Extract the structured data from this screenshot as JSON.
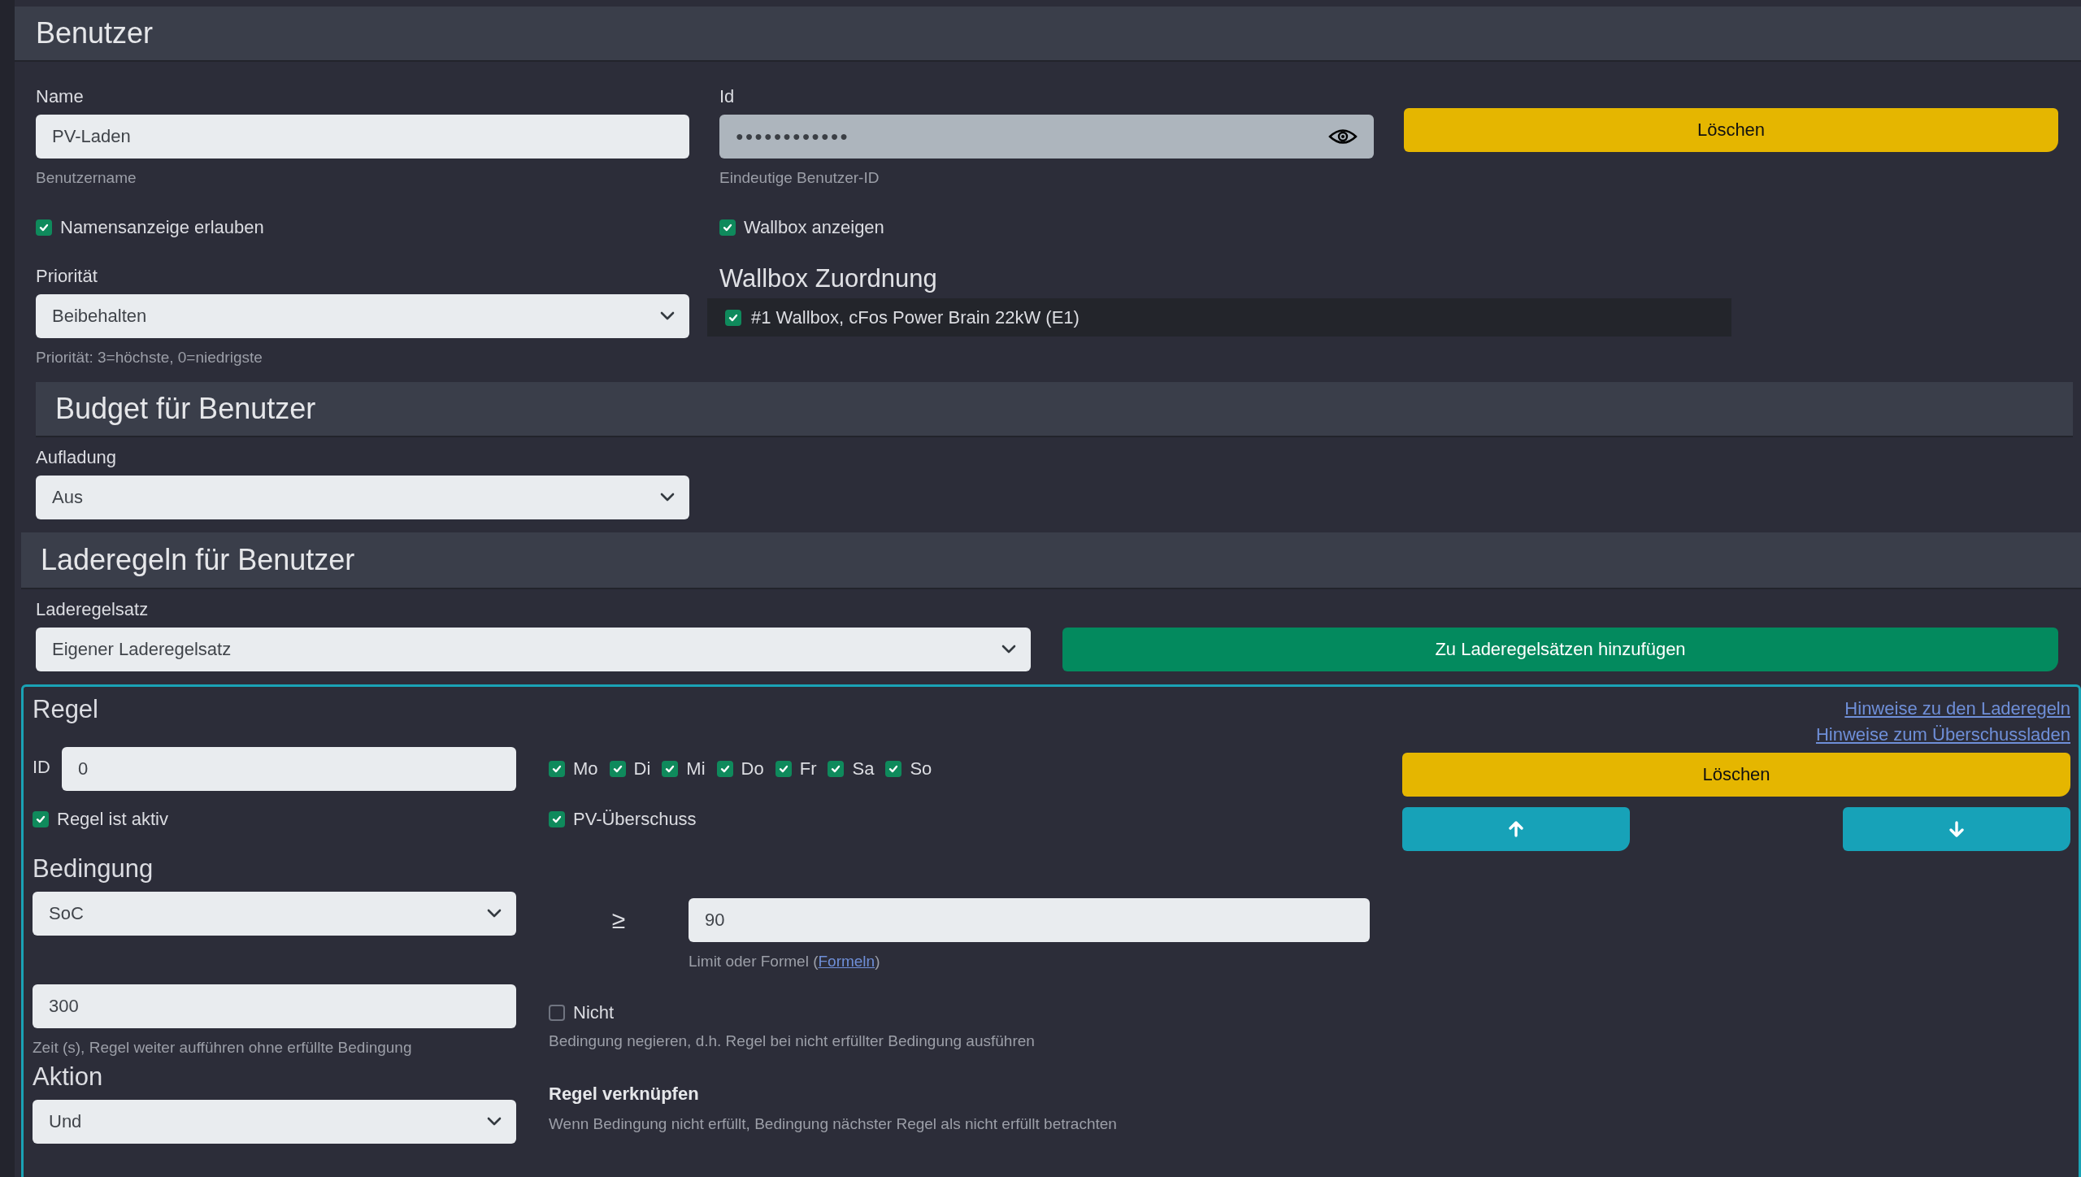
{
  "user": {
    "title": "Benutzer",
    "name": {
      "label": "Name",
      "value": "PV-Laden",
      "hint": "Benutzername"
    },
    "id": {
      "label": "Id",
      "value": "●●●●●●●●●●●●",
      "hint": "Eindeutige Benutzer-ID"
    },
    "delete_button": "Löschen",
    "show_name": {
      "label": "Namensanzeige erlauben",
      "checked": true
    },
    "show_wallbox": {
      "label": "Wallbox anzeigen",
      "checked": true
    },
    "priority": {
      "label": "Priorität",
      "value": "Beibehalten",
      "hint": "Priorität: 3=höchste, 0=niedrigste"
    },
    "wallbox_assignment": {
      "title": "Wallbox Zuordnung",
      "items": [
        {
          "label": "#1 Wallbox, cFos Power Brain 22kW (E1)",
          "checked": true
        }
      ]
    }
  },
  "budget": {
    "title": "Budget für Benutzer",
    "charging": {
      "label": "Aufladung",
      "value": "Aus"
    }
  },
  "rules": {
    "title": "Laderegeln für Benutzer",
    "ruleset": {
      "label": "Laderegelsatz",
      "value": "Eigener Laderegelsatz"
    },
    "add_button": "Zu Laderegelsätzen hinzufügen",
    "rule": {
      "title": "Regel",
      "links": [
        "Hinweise zu den Laderegeln",
        "Hinweise zum Überschussladen"
      ],
      "id": {
        "label": "ID",
        "value": "0"
      },
      "days": [
        {
          "label": "Mo",
          "checked": true
        },
        {
          "label": "Di",
          "checked": true
        },
        {
          "label": "Mi",
          "checked": true
        },
        {
          "label": "Do",
          "checked": true
        },
        {
          "label": "Fr",
          "checked": true
        },
        {
          "label": "Sa",
          "checked": true
        },
        {
          "label": "So",
          "checked": true
        }
      ],
      "active": {
        "label": "Regel ist aktiv",
        "checked": true
      },
      "pv_surplus": {
        "label": "PV-Überschuss",
        "checked": true
      },
      "delete_button": "Löschen",
      "condition": {
        "title": "Bedingung",
        "variable": "SoC",
        "operator": "≥",
        "limit": "90",
        "limit_hint": {
          "before": "Limit oder Formel (",
          "link": "Formeln",
          "after": ")"
        },
        "duration": "300",
        "duration_hint": "Zeit (s), Regel weiter aufführen ohne erfüllte Bedingung",
        "negate": {
          "label": "Nicht",
          "checked": false,
          "hint": "Bedingung negieren, d.h. Regel bei nicht erfüllter Bedingung ausführen"
        }
      },
      "action": {
        "title": "Aktion",
        "value": "Und",
        "link_title": "Regel verknüpfen",
        "link_hint": "Wenn Bedingung nicht erfüllt, Bedingung nächster Regel als nicht erfüllt betrachten"
      }
    }
  }
}
